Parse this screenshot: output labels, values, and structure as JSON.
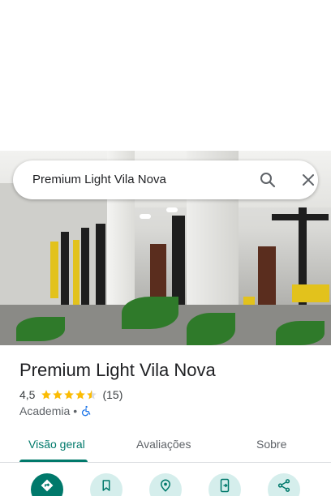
{
  "search": {
    "query": "Premium Light Vila Nova"
  },
  "place": {
    "title": "Premium Light Vila Nova",
    "rating": "4,5",
    "rating_value": 4.5,
    "review_count": "(15)",
    "category": "Academia",
    "separator": "•"
  },
  "tabs": [
    {
      "label": "Visão geral"
    },
    {
      "label": "Avaliações"
    },
    {
      "label": "Sobre"
    }
  ],
  "actions": [
    {
      "icon": "directions-icon"
    },
    {
      "icon": "bookmark-icon"
    },
    {
      "icon": "nearby-icon"
    },
    {
      "icon": "send-to-phone-icon"
    },
    {
      "icon": "share-icon"
    }
  ],
  "colors": {
    "accent": "#00796b",
    "star": "#fbbc04",
    "accessible": "#1a73e8"
  }
}
